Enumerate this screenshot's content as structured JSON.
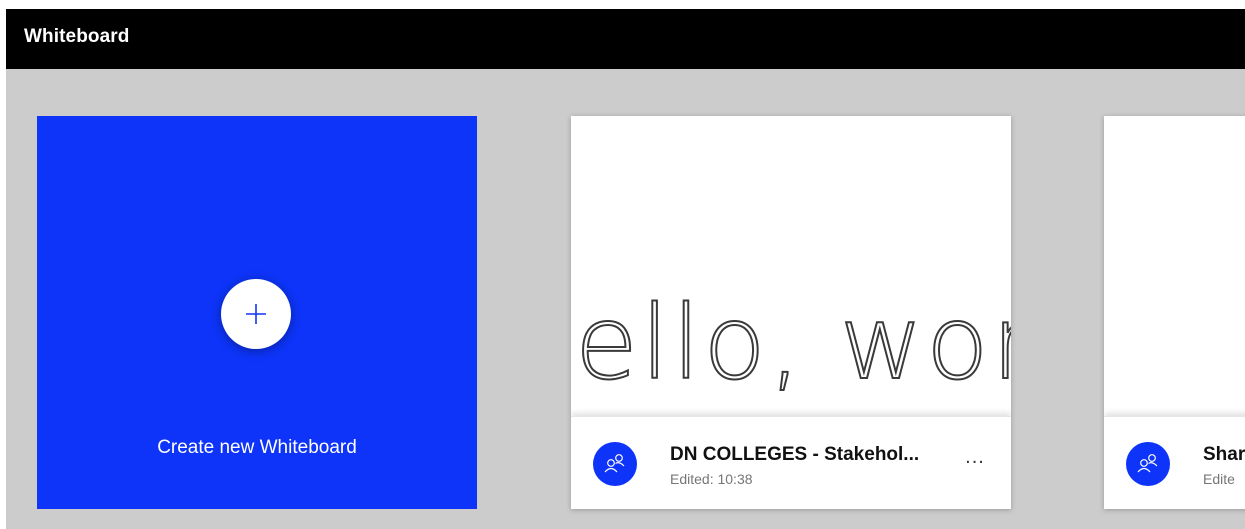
{
  "app": {
    "title": "Whiteboard"
  },
  "create_tile": {
    "label": "Create new Whiteboard",
    "icon": "plus-icon"
  },
  "boards": [
    {
      "title": "DN COLLEGES - Stakehol...",
      "subtitle": "Edited: 10:38",
      "thumbnail_text": "ello, worl",
      "icon": "shared-people-icon",
      "more_label": "..."
    },
    {
      "title": "Shar",
      "subtitle": "Edite",
      "icon": "shared-people-icon"
    }
  ],
  "colors": {
    "accent": "#0d34f8",
    "titlebar": "#000000",
    "background": "#cccccc",
    "card": "#ffffff"
  }
}
